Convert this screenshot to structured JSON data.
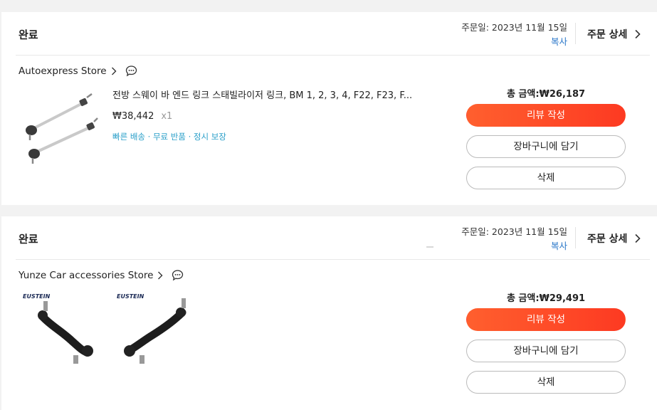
{
  "orders": [
    {
      "status": "완료",
      "order_date": "주문일: 2023년 11월 15일",
      "copy": "복사",
      "detail": "주문 상세",
      "store": "Autoexpress Store",
      "title": "전방 스웨이 바 엔드 링크 스태빌라이저 링크, BM 1, 2, 3, 4, F22, F23, F...",
      "price": "₩38,442",
      "qty": "x1",
      "benefits": "빠른 배송 · 무료 반품 · 정시 보장",
      "total": "총 금액:₩26,187",
      "review_btn": "리뷰 작성",
      "cart_btn": "장바구니에 담기",
      "delete_btn": "삭제"
    },
    {
      "status": "완료",
      "order_date": "주문일: 2023년 11월 15일",
      "copy": "복사",
      "detail": "주문 상세",
      "store": "Yunze Car accessories Store",
      "brand_logo": "EUSTEIN",
      "total": "총 금액:₩29,491",
      "review_btn": "리뷰 작성",
      "cart_btn": "장바구니에 담기",
      "delete_btn": "삭제"
    }
  ],
  "colors": {
    "accent_start": "#ff5f2e",
    "accent_end": "#fd3a22",
    "link": "#2a77c9",
    "benefit": "#2a9fc9"
  },
  "icons": [
    "chevron-right-icon",
    "chat-bubble-icon"
  ]
}
